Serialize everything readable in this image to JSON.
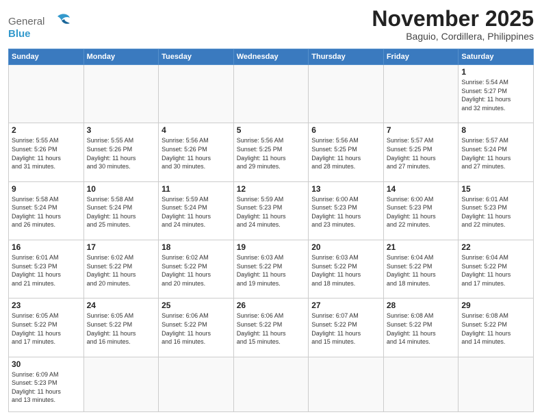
{
  "header": {
    "logo_general": "General",
    "logo_blue": "Blue",
    "month_title": "November 2025",
    "location": "Baguio, Cordillera, Philippines"
  },
  "weekdays": [
    "Sunday",
    "Monday",
    "Tuesday",
    "Wednesday",
    "Thursday",
    "Friday",
    "Saturday"
  ],
  "weeks": [
    [
      {
        "day": "",
        "info": ""
      },
      {
        "day": "",
        "info": ""
      },
      {
        "day": "",
        "info": ""
      },
      {
        "day": "",
        "info": ""
      },
      {
        "day": "",
        "info": ""
      },
      {
        "day": "",
        "info": ""
      },
      {
        "day": "1",
        "info": "Sunrise: 5:54 AM\nSunset: 5:27 PM\nDaylight: 11 hours\nand 32 minutes."
      }
    ],
    [
      {
        "day": "2",
        "info": "Sunrise: 5:55 AM\nSunset: 5:26 PM\nDaylight: 11 hours\nand 31 minutes."
      },
      {
        "day": "3",
        "info": "Sunrise: 5:55 AM\nSunset: 5:26 PM\nDaylight: 11 hours\nand 30 minutes."
      },
      {
        "day": "4",
        "info": "Sunrise: 5:56 AM\nSunset: 5:26 PM\nDaylight: 11 hours\nand 30 minutes."
      },
      {
        "day": "5",
        "info": "Sunrise: 5:56 AM\nSunset: 5:25 PM\nDaylight: 11 hours\nand 29 minutes."
      },
      {
        "day": "6",
        "info": "Sunrise: 5:56 AM\nSunset: 5:25 PM\nDaylight: 11 hours\nand 28 minutes."
      },
      {
        "day": "7",
        "info": "Sunrise: 5:57 AM\nSunset: 5:25 PM\nDaylight: 11 hours\nand 27 minutes."
      },
      {
        "day": "8",
        "info": "Sunrise: 5:57 AM\nSunset: 5:24 PM\nDaylight: 11 hours\nand 27 minutes."
      }
    ],
    [
      {
        "day": "9",
        "info": "Sunrise: 5:58 AM\nSunset: 5:24 PM\nDaylight: 11 hours\nand 26 minutes."
      },
      {
        "day": "10",
        "info": "Sunrise: 5:58 AM\nSunset: 5:24 PM\nDaylight: 11 hours\nand 25 minutes."
      },
      {
        "day": "11",
        "info": "Sunrise: 5:59 AM\nSunset: 5:24 PM\nDaylight: 11 hours\nand 24 minutes."
      },
      {
        "day": "12",
        "info": "Sunrise: 5:59 AM\nSunset: 5:23 PM\nDaylight: 11 hours\nand 24 minutes."
      },
      {
        "day": "13",
        "info": "Sunrise: 6:00 AM\nSunset: 5:23 PM\nDaylight: 11 hours\nand 23 minutes."
      },
      {
        "day": "14",
        "info": "Sunrise: 6:00 AM\nSunset: 5:23 PM\nDaylight: 11 hours\nand 22 minutes."
      },
      {
        "day": "15",
        "info": "Sunrise: 6:01 AM\nSunset: 5:23 PM\nDaylight: 11 hours\nand 22 minutes."
      }
    ],
    [
      {
        "day": "16",
        "info": "Sunrise: 6:01 AM\nSunset: 5:23 PM\nDaylight: 11 hours\nand 21 minutes."
      },
      {
        "day": "17",
        "info": "Sunrise: 6:02 AM\nSunset: 5:22 PM\nDaylight: 11 hours\nand 20 minutes."
      },
      {
        "day": "18",
        "info": "Sunrise: 6:02 AM\nSunset: 5:22 PM\nDaylight: 11 hours\nand 20 minutes."
      },
      {
        "day": "19",
        "info": "Sunrise: 6:03 AM\nSunset: 5:22 PM\nDaylight: 11 hours\nand 19 minutes."
      },
      {
        "day": "20",
        "info": "Sunrise: 6:03 AM\nSunset: 5:22 PM\nDaylight: 11 hours\nand 18 minutes."
      },
      {
        "day": "21",
        "info": "Sunrise: 6:04 AM\nSunset: 5:22 PM\nDaylight: 11 hours\nand 18 minutes."
      },
      {
        "day": "22",
        "info": "Sunrise: 6:04 AM\nSunset: 5:22 PM\nDaylight: 11 hours\nand 17 minutes."
      }
    ],
    [
      {
        "day": "23",
        "info": "Sunrise: 6:05 AM\nSunset: 5:22 PM\nDaylight: 11 hours\nand 17 minutes."
      },
      {
        "day": "24",
        "info": "Sunrise: 6:05 AM\nSunset: 5:22 PM\nDaylight: 11 hours\nand 16 minutes."
      },
      {
        "day": "25",
        "info": "Sunrise: 6:06 AM\nSunset: 5:22 PM\nDaylight: 11 hours\nand 16 minutes."
      },
      {
        "day": "26",
        "info": "Sunrise: 6:06 AM\nSunset: 5:22 PM\nDaylight: 11 hours\nand 15 minutes."
      },
      {
        "day": "27",
        "info": "Sunrise: 6:07 AM\nSunset: 5:22 PM\nDaylight: 11 hours\nand 15 minutes."
      },
      {
        "day": "28",
        "info": "Sunrise: 6:08 AM\nSunset: 5:22 PM\nDaylight: 11 hours\nand 14 minutes."
      },
      {
        "day": "29",
        "info": "Sunrise: 6:08 AM\nSunset: 5:22 PM\nDaylight: 11 hours\nand 14 minutes."
      }
    ],
    [
      {
        "day": "30",
        "info": "Sunrise: 6:09 AM\nSunset: 5:23 PM\nDaylight: 11 hours\nand 13 minutes."
      },
      {
        "day": "",
        "info": ""
      },
      {
        "day": "",
        "info": ""
      },
      {
        "day": "",
        "info": ""
      },
      {
        "day": "",
        "info": ""
      },
      {
        "day": "",
        "info": ""
      },
      {
        "day": "",
        "info": ""
      }
    ]
  ]
}
